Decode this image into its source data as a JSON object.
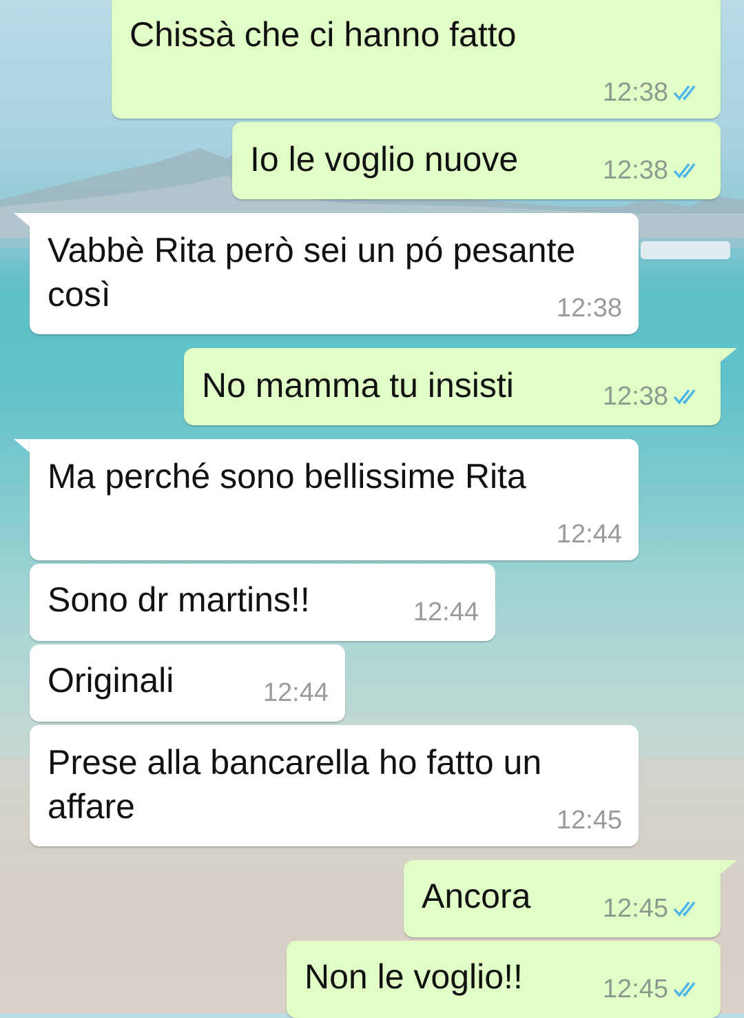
{
  "conversation": {
    "messages": [
      {
        "id": "m1",
        "direction": "outgoing",
        "text": "Chissà che ci hanno fatto",
        "time": "12:38",
        "status": "read"
      },
      {
        "id": "m2",
        "direction": "outgoing",
        "text": "Io le voglio nuove",
        "time": "12:38",
        "status": "read"
      },
      {
        "id": "m3",
        "direction": "incoming",
        "text": "Vabbè Rita però sei un pó pesante\ncosì",
        "time": "12:38"
      },
      {
        "id": "m4",
        "direction": "outgoing",
        "text": "No mamma tu insisti",
        "time": "12:38",
        "status": "read"
      },
      {
        "id": "m5",
        "direction": "incoming",
        "text": "Ma perché sono bellissime Rita",
        "time": "12:44"
      },
      {
        "id": "m6",
        "direction": "incoming",
        "text": "Sono dr martins!!",
        "time": "12:44"
      },
      {
        "id": "m7",
        "direction": "incoming",
        "text": "Originali",
        "time": "12:44"
      },
      {
        "id": "m8",
        "direction": "incoming",
        "text": "Prese alla bancarella ho fatto un\naffare",
        "time": "12:45"
      },
      {
        "id": "m9",
        "direction": "outgoing",
        "text": "Ancora",
        "time": "12:45",
        "status": "read"
      },
      {
        "id": "m10",
        "direction": "outgoing",
        "text": "Non le voglio!!",
        "time": "12:45",
        "status": "read"
      }
    ]
  },
  "colors": {
    "outgoing_bubble": "#e1fec6",
    "incoming_bubble": "#ffffff",
    "read_ticks": "#4fb6ec"
  },
  "icons": {
    "read_status": "double-check-icon"
  }
}
